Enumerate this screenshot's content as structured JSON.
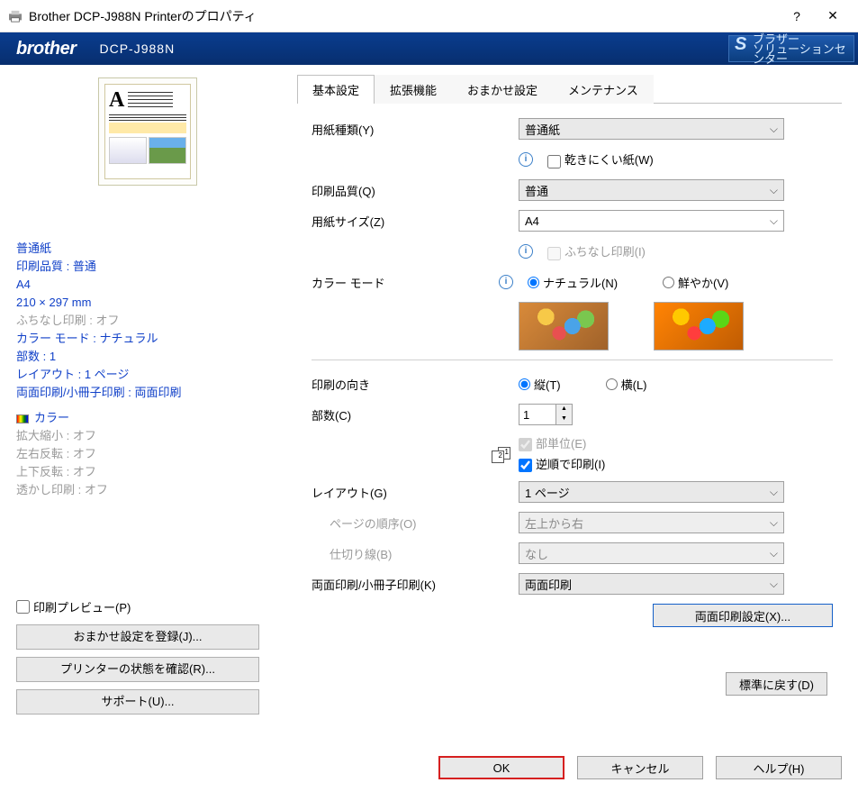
{
  "window": {
    "title": "Brother DCP-J988N Printerのプロパティ",
    "help": "?",
    "close": "✕"
  },
  "brand": {
    "logo": "brother",
    "model": "DCP-J988N",
    "solutions_line1": "ブラザー",
    "solutions_line2": "ソリューションセンター"
  },
  "tabs": [
    "基本設定",
    "拡張機能",
    "おまかせ設定",
    "メンテナンス"
  ],
  "sidebar": {
    "summary": {
      "media": "普通紙",
      "quality": "印刷品質 : 普通",
      "size": "A4",
      "dims": "210 × 297 mm",
      "borderless": "ふちなし印刷 : オフ",
      "colormode": "カラー モード : ナチュラル",
      "copies": "部数 : 1",
      "layout": "レイアウト : 1 ページ",
      "duplex": "両面印刷/小冊子印刷 : 両面印刷",
      "color": "カラー",
      "scale": "拡大縮小 : オフ",
      "mirror": "左右反転 : オフ",
      "flip": "上下反転 : オフ",
      "watermark": "透かし印刷 : オフ"
    },
    "preview_cb": "印刷プレビュー(P)",
    "btn_register": "おまかせ設定を登録(J)...",
    "btn_status": "プリンターの状態を確認(R)...",
    "btn_support": "サポート(U)..."
  },
  "form": {
    "media_label": "用紙種類(Y)",
    "media_value": "普通紙",
    "slowdry": "乾きにくい紙(W)",
    "quality_label": "印刷品質(Q)",
    "quality_value": "普通",
    "size_label": "用紙サイズ(Z)",
    "size_value": "A4",
    "borderless": "ふちなし印刷(I)",
    "colormode_label": "カラー モード",
    "natural": "ナチュラル(N)",
    "vivid": "鮮やか(V)",
    "orient_label": "印刷の向き",
    "portrait": "縦(T)",
    "landscape": "横(L)",
    "copies_label": "部数(C)",
    "copies_value": "1",
    "collate": "部単位(E)",
    "reverse": "逆順で印刷(I)",
    "layout_label": "レイアウト(G)",
    "layout_value": "1 ページ",
    "pageorder_label": "ページの順序(O)",
    "pageorder_value": "左上から右",
    "borderline_label": "仕切り線(B)",
    "borderline_value": "なし",
    "duplex_label": "両面印刷/小冊子印刷(K)",
    "duplex_value": "両面印刷",
    "duplex_settings": "両面印刷設定(X)...",
    "reset": "標準に戻す(D)"
  },
  "buttons": {
    "ok": "OK",
    "cancel": "キャンセル",
    "help": "ヘルプ(H)"
  }
}
